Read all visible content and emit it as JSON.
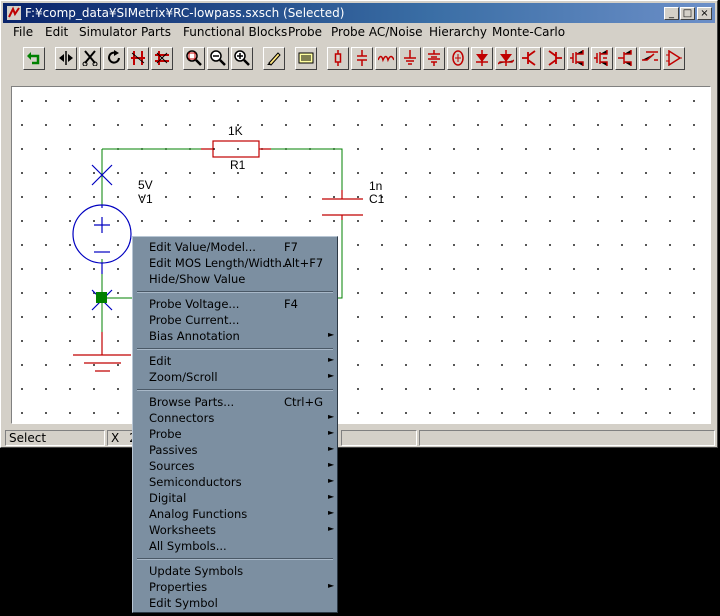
{
  "window": {
    "title": "F:¥comp_data¥SIMetrix¥RC-lowpass.sxsch (Selected)",
    "min_label": "_",
    "max_label": "□",
    "close_label": "×"
  },
  "menubar": {
    "file": "File",
    "edit": "Edit",
    "simulator": "Simulator",
    "parts": "Parts",
    "functional_blocks": "Functional Blocks",
    "probe": "Probe",
    "probe_ac_noise": "Probe AC/Noise",
    "hierarchy": "Hierarchy",
    "monte_carlo": "Monte-Carlo"
  },
  "toolbar": {
    "icons": [
      "undo-icon",
      "flip-icon",
      "cut-icon",
      "rotate-icon",
      "wire-break-icon",
      "delete-wire-icon",
      "zoom-full-icon",
      "zoom-out-icon",
      "zoom-in-icon",
      "pencil-icon",
      "netlist-icon",
      "resistor-icon",
      "capacitor-icon",
      "inductor-icon",
      "ground-icon",
      "battery-icon",
      "source-icon",
      "diode-icon",
      "zener-icon",
      "npn-icon",
      "pnp-icon",
      "nmos-icon",
      "pmos-icon",
      "opamp-icon"
    ]
  },
  "schematic": {
    "r1_value": "1K",
    "r1_name": "R1",
    "c1_value": "1n",
    "c1_name": "C1",
    "v1_value": "5V",
    "v1_name": "V1",
    "colors": {
      "wire": "#008000",
      "component": "#c00000",
      "source": "#0000c0"
    }
  },
  "statusbar": {
    "mode": "Select",
    "x_label": "X",
    "x_value": "2"
  },
  "context_menu": {
    "edit_value_model": "Edit Value/Model...",
    "edit_value_model_sc": "F7",
    "edit_mos": "Edit MOS Length/Width...",
    "edit_mos_sc": "Alt+F7",
    "hide_show_value": "Hide/Show Value",
    "probe_voltage": "Probe Voltage...",
    "probe_voltage_sc": "F4",
    "probe_current": "Probe Current...",
    "bias_annotation": "Bias Annotation",
    "edit": "Edit",
    "zoom_scroll": "Zoom/Scroll",
    "browse_parts": "Browse Parts...",
    "browse_parts_sc": "Ctrl+G",
    "connectors": "Connectors",
    "probe": "Probe",
    "passives": "Passives",
    "sources": "Sources",
    "semiconductors": "Semiconductors",
    "digital": "Digital",
    "analog_functions": "Analog Functions",
    "worksheets": "Worksheets",
    "all_symbols": "All Symbols...",
    "update_symbols": "Update Symbols",
    "properties": "Properties",
    "edit_symbol": "Edit Symbol",
    "submenu_arrow": "►"
  }
}
